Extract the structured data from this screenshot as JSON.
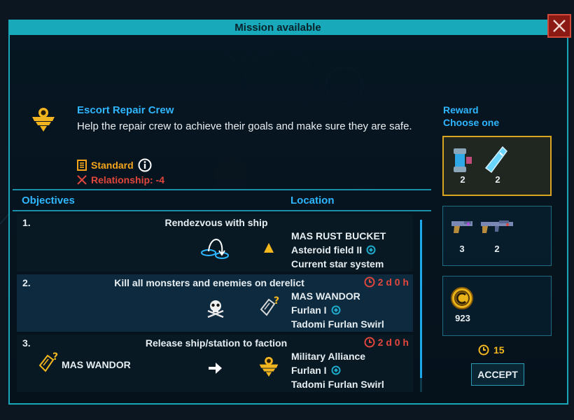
{
  "window": {
    "title": "Mission available",
    "close_icon": "close-icon"
  },
  "mission": {
    "name": "Escort Repair Crew",
    "description": "Help the repair crew to achieve their goals and make sure they are safe.",
    "emblem_icon": "military-wings-emblem-icon",
    "difficulty": "Standard",
    "relationship": "Relationship: -4"
  },
  "headers": {
    "objectives": "Objectives",
    "location": "Location"
  },
  "objectives": [
    {
      "number": "1.",
      "title": "Rendezvous with ship",
      "icon": "rendezvous-icon",
      "location_icon": "ship-marker-icon",
      "location": [
        "MAS RUST BUCKET",
        "Asteroid field II",
        "Current star system"
      ],
      "timer": ""
    },
    {
      "number": "2.",
      "title": "Kill all monsters and enemies on derelict",
      "icon": "skull-crossbones-icon",
      "location_icon": "unknown-derelict-icon",
      "location": [
        "MAS WANDOR",
        "Furlan I",
        "Tadomi Furlan Swirl"
      ],
      "timer": "2 d 0 h"
    },
    {
      "number": "3.",
      "title": "Release ship/station to faction",
      "source_icon": "unknown-derelict-icon",
      "source": "MAS WANDOR",
      "icon": "arrow-right-icon",
      "location_icon": "military-wings-emblem-icon",
      "location": [
        "Military Alliance",
        "Furlan I",
        "Tadomi Furlan Swirl"
      ],
      "timer": "2 d 0 h"
    }
  ],
  "reward": {
    "title": "Reward",
    "subtitle": "Choose one",
    "options": [
      {
        "selected": true,
        "items": [
          {
            "icon": "power-coil-icon",
            "qty": "2"
          },
          {
            "icon": "energy-crystal-icon",
            "qty": "2"
          }
        ]
      },
      {
        "selected": false,
        "items": [
          {
            "icon": "pistol-icon",
            "qty": "3"
          },
          {
            "icon": "rifle-icon",
            "qty": "2"
          }
        ]
      },
      {
        "selected": false,
        "items": [
          {
            "icon": "credits-coin-icon",
            "qty": "923"
          }
        ]
      }
    ]
  },
  "duration": "15",
  "accept_label": "ACCEPT",
  "colors": {
    "accent": "#18a9bb",
    "link": "#2eb6ff",
    "gold": "#f4a51c",
    "danger": "#e0463c"
  }
}
